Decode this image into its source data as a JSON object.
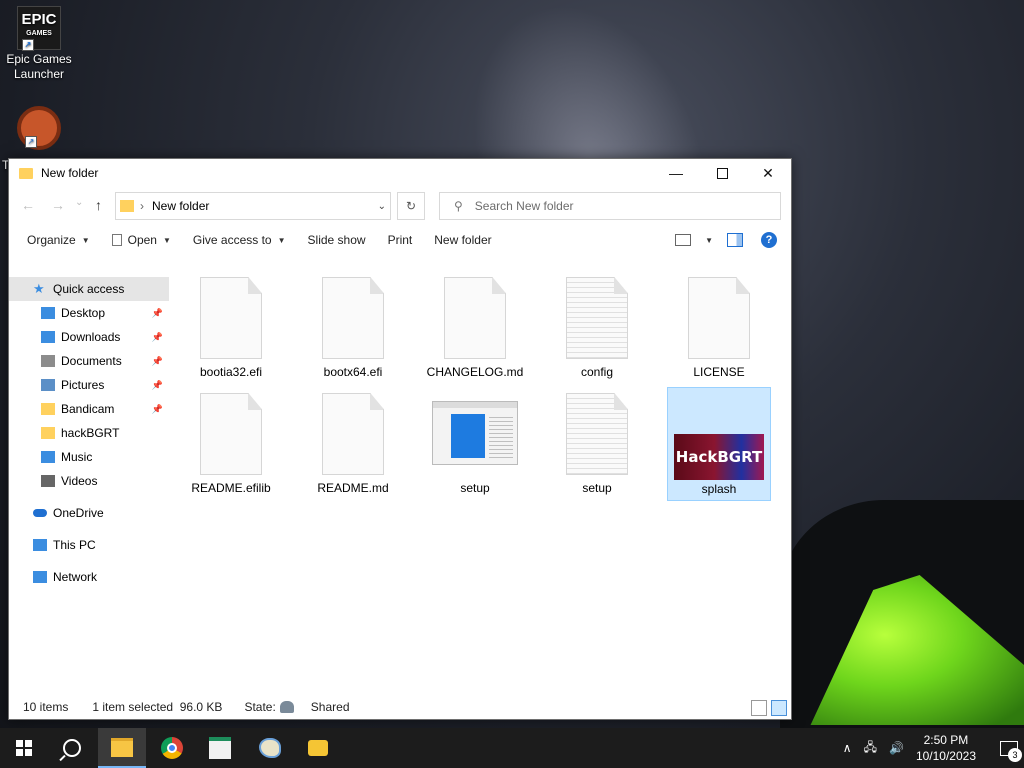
{
  "desktop": {
    "icons": [
      {
        "label": "Epic Games Launcher",
        "logo_line1": "EPIC",
        "logo_line2": "GAMES"
      },
      {
        "label": "T"
      }
    ]
  },
  "window": {
    "title": "New folder",
    "controls": {
      "minimize": "—",
      "close": "✕"
    },
    "nav": {
      "back": "←",
      "forward": "→",
      "recent": "⌄",
      "up": "↑"
    },
    "address": {
      "separator": "›",
      "path": "New folder",
      "dropdown": "⌄"
    },
    "refresh": "↻",
    "search": {
      "placeholder": "Search New folder"
    },
    "toolbar": {
      "organize": "Organize",
      "open": "Open",
      "give_access": "Give access to",
      "slide_show": "Slide show",
      "print": "Print",
      "new_folder": "New folder",
      "help": "?"
    },
    "navpane": [
      {
        "label": "Quick access",
        "icon": "star-icon",
        "color": "#3b8de0"
      },
      {
        "label": "Desktop",
        "icon": "desktop-icon",
        "color": "#3b8de0",
        "pinned": true
      },
      {
        "label": "Downloads",
        "icon": "download-icon",
        "color": "#3b8de0",
        "pinned": true
      },
      {
        "label": "Documents",
        "icon": "documents-icon",
        "color": "#8c8c8c",
        "pinned": true
      },
      {
        "label": "Pictures",
        "icon": "pictures-icon",
        "color": "#5b8fc7",
        "pinned": true
      },
      {
        "label": "Bandicam",
        "icon": "folder-icon",
        "color": "#ffd15e",
        "pinned": true
      },
      {
        "label": "hackBGRT",
        "icon": "folder-icon",
        "color": "#ffd15e"
      },
      {
        "label": "Music",
        "icon": "music-icon",
        "color": "#3b8de0"
      },
      {
        "label": "Videos",
        "icon": "videos-icon",
        "color": "#666666"
      },
      {
        "label": "OneDrive",
        "icon": "onedrive-icon",
        "color": "#1f6fd1"
      },
      {
        "label": "This PC",
        "icon": "computer-icon",
        "color": "#3b8de0"
      },
      {
        "label": "Network",
        "icon": "network-icon",
        "color": "#3b8de0"
      }
    ],
    "pin_glyph": "📌",
    "files": [
      {
        "name": "bootia32.efi",
        "kind": "blank"
      },
      {
        "name": "bootx64.efi",
        "kind": "blank"
      },
      {
        "name": "CHANGELOG.md",
        "kind": "blank"
      },
      {
        "name": "config",
        "kind": "lined"
      },
      {
        "name": "LICENSE",
        "kind": "blank"
      },
      {
        "name": "README.efilib",
        "kind": "blank"
      },
      {
        "name": "README.md",
        "kind": "blank"
      },
      {
        "name": "setup",
        "kind": "app"
      },
      {
        "name": "setup",
        "kind": "lined"
      },
      {
        "name": "splash",
        "kind": "image",
        "thumb_text": "HackBGRT",
        "selected": true
      }
    ],
    "status": {
      "count": "10 items",
      "selection": "1 item selected  96.0 KB",
      "state_label": "State:",
      "state_value": "Shared"
    }
  },
  "taskbar": {
    "tray_chevron": "∧",
    "network": "🖧",
    "volume": "🔊",
    "time": "2:50 PM",
    "date": "10/10/2023",
    "notifications": "3"
  }
}
